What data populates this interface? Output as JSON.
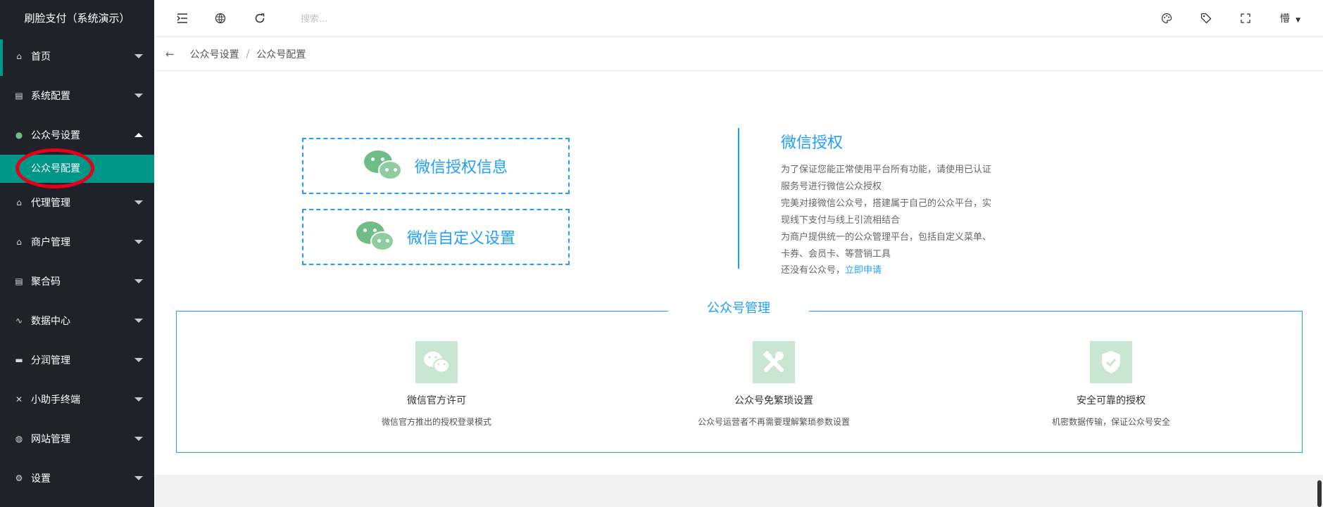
{
  "app": {
    "title": "刷脸支付（系统演示）"
  },
  "sidebar": {
    "items": [
      {
        "label": "首页",
        "icon": "home-icon"
      },
      {
        "label": "系统配置",
        "icon": "config-icon"
      },
      {
        "label": "公众号设置",
        "icon": "wechat-icon",
        "expanded": true,
        "children": [
          {
            "label": "公众号配置"
          }
        ]
      },
      {
        "label": "代理管理",
        "icon": "home-icon"
      },
      {
        "label": "商户管理",
        "icon": "home-icon"
      },
      {
        "label": "聚合码",
        "icon": "config-icon"
      },
      {
        "label": "数据中心",
        "icon": "pulse-icon"
      },
      {
        "label": "分润管理",
        "icon": "monitor-icon"
      },
      {
        "label": "小助手终端",
        "icon": "tools-icon"
      },
      {
        "label": "网站管理",
        "icon": "globe-icon"
      },
      {
        "label": "设置",
        "icon": "gear-icon"
      }
    ]
  },
  "header": {
    "search_placeholder": "搜索...",
    "user": "懵"
  },
  "breadcrumb": {
    "items": [
      "公众号设置",
      "公众号配置"
    ],
    "separator": "/"
  },
  "wechat_buttons": {
    "auth_info": "微信授权信息",
    "custom_settings": "微信自定义设置"
  },
  "auth_panel": {
    "title": "微信授权",
    "p1": "为了保证您能正常使用平台所有功能，请使用已认证服务号进行微信公众授权",
    "p2": "完美对接微信公众号，搭建属于自己的公众平台，实现线下支付与线上引流相结合",
    "p3": "为商户提供统一的公众管理平台，包括自定义菜单、卡券、会员卡、等营销工具",
    "p4_prefix": "还没有公众号，",
    "p4_link": "立即申请"
  },
  "management": {
    "title": "公众号管理",
    "features": [
      {
        "title": "微信官方许可",
        "desc": "微信官方推出的授权登录模式",
        "icon": "wechat-icon"
      },
      {
        "title": "公众号免繁琐设置",
        "desc": "公众号运营者不再需要理解繁琐参数设置",
        "icon": "tools-icon"
      },
      {
        "title": "安全可靠的授权",
        "desc": "机密数据传输，保证公众号安全",
        "icon": "shield-check-icon"
      }
    ]
  },
  "colors": {
    "sidebar_bg": "#20222a",
    "accent": "#009688",
    "link_blue": "#1e9fff",
    "icon_green": "#c9e6d2",
    "annotation_red": "#e2001a"
  }
}
